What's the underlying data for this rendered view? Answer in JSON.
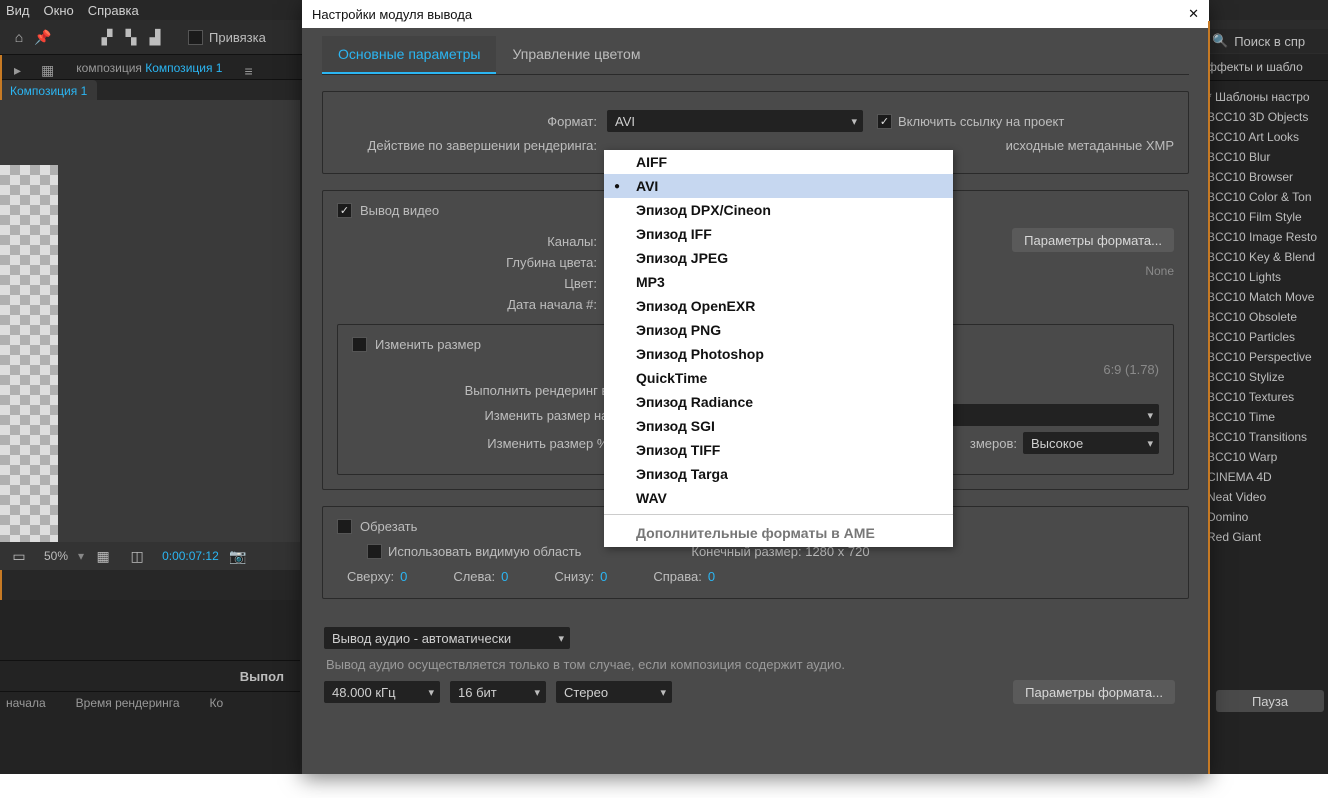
{
  "menu": {
    "view": "Вид",
    "window": "Окно",
    "help": "Справка"
  },
  "toolbar": {
    "binding": "Привязка"
  },
  "search": {
    "placeholder": "Поиск в спр"
  },
  "panel": {
    "composition_tab": "композиция",
    "composition_name": "Композиция 1",
    "sub_tab": "Композиция 1"
  },
  "viewer": {
    "zoom": "50%",
    "timecode": "0:00:07:12"
  },
  "render_queue": {
    "tab": "Выпол",
    "col_start": "начала",
    "col_rendertime": "Время рендеринга",
    "col_comment": "Ко"
  },
  "right": {
    "header": "ффекты и шабло",
    "items": [
      "* Шаблоны настро",
      "BCC10 3D Objects",
      "BCC10 Art Looks",
      "BCC10 Blur",
      "BCC10 Browser",
      "BCC10 Color & Ton",
      "BCC10 Film Style",
      "BCC10 Image Resto",
      "BCC10 Key & Blend",
      "BCC10 Lights",
      "BCC10 Match Move",
      "BCC10 Obsolete",
      "BCC10 Particles",
      "BCC10 Perspective",
      "BCC10 Stylize",
      "BCC10 Textures",
      "BCC10 Time",
      "BCC10 Transitions",
      "BCC10 Warp",
      "CINEMA 4D",
      "Neat Video",
      "Domino",
      "Red Giant"
    ],
    "pause": "Пауза"
  },
  "dialog": {
    "title": "Настройки модуля вывода",
    "tabs": {
      "main": "Основные параметры",
      "color": "Управление цветом"
    },
    "format_label": "Формат:",
    "format_value": "AVI",
    "include_proj": "Включить ссылку на проект",
    "after_render": "Действие по завершении рендеринга:",
    "xmp": "исходные метаданные XMP",
    "video_out": "Вывод видео",
    "channels": "Каналы:",
    "depth": "Глубина цвета:",
    "color": "Цвет:",
    "start_no": "Дата начала #:",
    "format_options": "Параметры формата...",
    "none": "None",
    "resize_title": "Изменить размер",
    "aspect_note": "6:9 (1.78)",
    "render_at": "Выполнить рендеринг в:",
    "resize_to": "Изменить размер на:",
    "resize_pct": "Изменить размер %:",
    "quality_label": "змеров:",
    "quality_value": "Высокое",
    "crop_title": "Обрезать",
    "use_roi": "Использовать видимую область",
    "final_size": "Конечный размер: 1280 x 720",
    "top": "Сверху:",
    "left": "Слева:",
    "bottom": "Снизу:",
    "right": "Справа:",
    "zero": "0",
    "audio_auto": "Вывод аудио - автоматически",
    "audio_note": "Вывод аудио осуществляется только в том случае, если композиция содержит аудио.",
    "hz": "48.000 кГц",
    "bit": "16 бит",
    "stereo": "Стерео"
  },
  "format_options": [
    "AIFF",
    "AVI",
    "Эпизод DPX/Cineon",
    "Эпизод IFF",
    "Эпизод JPEG",
    "MP3",
    "Эпизод OpenEXR",
    "Эпизод PNG",
    "Эпизод Photoshop",
    "QuickTime",
    "Эпизод Radiance",
    "Эпизод SGI",
    "Эпизод TIFF",
    "Эпизод Targa",
    "WAV"
  ],
  "format_extra": "Дополнительные форматы в AME",
  "format_selected_index": 1
}
